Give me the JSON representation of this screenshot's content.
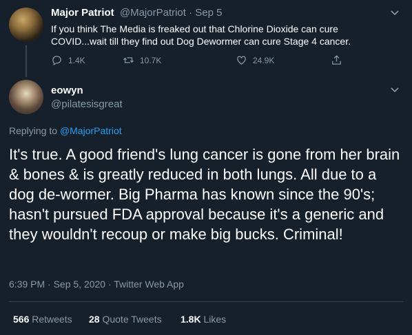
{
  "quoted_tweet": {
    "name": "Major Patriot",
    "handle": "@MajorPatriot",
    "separator": " · ",
    "date": "Sep 5",
    "text_line1": "If you think The Media is freaked out that Chlorine Dioxide can cure",
    "text_line2": "COVID...wait till they find out Dog Dewormer can cure Stage 4 cancer.",
    "replies": "1.4K",
    "retweets": "10.7K",
    "likes": "24.9K"
  },
  "main_tweet": {
    "name": "eowyn",
    "handle": "@pilatesisgreat",
    "replying_prefix": "Replying to ",
    "replying_to": "@MajorPatriot",
    "text": "It's true. A good friend's lung cancer is gone from her brain & bones & is greatly reduced in both lungs. All due to a dog de-wormer. Big Pharma has known since the 90's; hasn't pursued FDA approval because it's a generic and they wouldn't recoup or make big bucks. Criminal!",
    "timestamp": "6:39 PM · Sep 5, 2020 · Twitter Web App",
    "retweets_count": "566",
    "retweets_label": " Retweets",
    "quote_count": "28",
    "quote_label": " Quote Tweets",
    "likes_count": "1.8K",
    "likes_label": " Likes"
  },
  "icons": {
    "reply": "reply-icon",
    "retweet": "retweet-icon",
    "like": "heart-icon",
    "share": "share-icon",
    "more": "chevron-down-icon"
  },
  "colors": {
    "background": "#15202b",
    "muted": "#8899a6",
    "link": "#1da1f2",
    "divider": "#38444d"
  }
}
